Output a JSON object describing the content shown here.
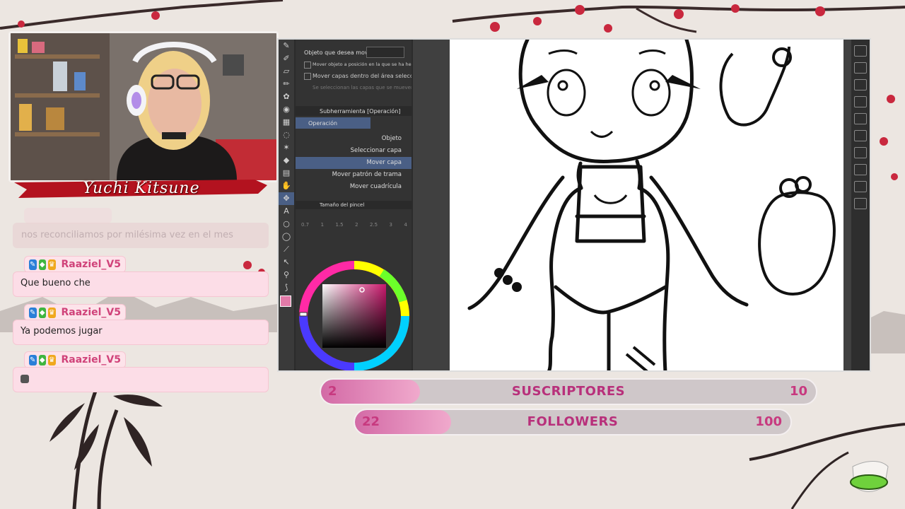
{
  "streamer": {
    "name_banner": "Yuchi  Kitsune"
  },
  "chat": {
    "ghost_message": "nos reconciliamos por milésima vez en el mes",
    "messages": [
      {
        "user": "Raaziel_V5",
        "text": "Que bueno che"
      },
      {
        "user": "Raaziel_V5",
        "text": "Ya podemos jugar"
      },
      {
        "user": "Raaziel_V5",
        "text": ""
      }
    ]
  },
  "app": {
    "tool_property": {
      "header": "Objeto que desea mover",
      "option1": "Mover objeto a posición en la que se ha hecho clic",
      "option2": "Mover capas dentro del área seleccionada",
      "option3": "Se seleccionan las capas que se mueven"
    },
    "subtool": {
      "title": "Subherramienta [Operación]",
      "group": "Operación",
      "items": [
        "Objeto",
        "Seleccionar capa",
        "Mover capa",
        "Mover patrón de trama",
        "Mover cuadrícula"
      ],
      "selected_index": 2
    },
    "brush_size": {
      "title": "Tamaño del pincel",
      "values": [
        "0.7",
        "1",
        "1.5",
        "2",
        "2.5",
        "3",
        "4"
      ]
    },
    "color": {
      "main": "#e27aa8",
      "picked": "#e489b8"
    }
  },
  "goals": {
    "subscribers": {
      "current": "2",
      "title": "SUSCRIPTORES",
      "target": "10",
      "progress": 0.2
    },
    "followers": {
      "current": "22",
      "title": "FOLLOWERS",
      "target": "100",
      "progress": 0.22
    }
  },
  "colors": {
    "accent": "#d0437a",
    "chat_bg": "#fcdde7",
    "goal_fill": "#e49bc4"
  }
}
